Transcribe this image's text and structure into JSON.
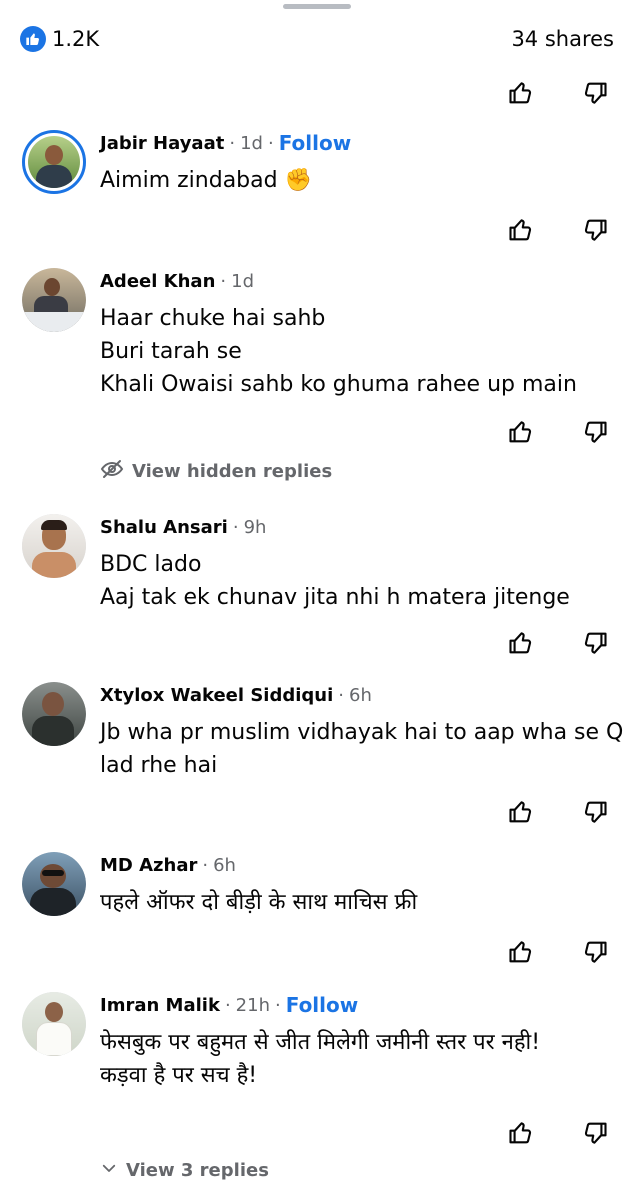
{
  "stats": {
    "likes": "1.2K",
    "shares": "34 shares"
  },
  "comments": [
    {
      "name": "Jabir Hayaat",
      "time": "1d",
      "follow": "Follow",
      "text": "Aimim zindabad ✊"
    },
    {
      "name": "Adeel Khan",
      "time": "1d",
      "text": "Haar chuke hai sahb\nBuri tarah se\nKhali Owaisi sahb ko ghuma rahee up main"
    },
    {
      "name": "Shalu Ansari",
      "time": "9h",
      "text": "BDC lado\nAaj tak ek chunav jita nhi h matera jitenge"
    },
    {
      "name": "Xtylox Wakeel Siddiqui",
      "time": "6h",
      "text": "Jb wha pr muslim vidhayak hai to aap wha se Q lad rhe hai"
    },
    {
      "name": "MD Azhar",
      "time": "6h",
      "text": "पहले ऑफर दो बीड़ी के साथ माचिस फ्री"
    },
    {
      "name": "Imran Malik",
      "time": "21h",
      "follow": "Follow",
      "text": "फेसबुक पर बहुमत से जीत मिलेगी जमीनी स्तर पर नही!\nकड़वा है पर सच है!"
    }
  ],
  "hidden_replies": "View hidden replies",
  "view_replies": "View 3 replies",
  "colors": {
    "accent": "#1b74e4",
    "secondary_text": "#65676b"
  }
}
